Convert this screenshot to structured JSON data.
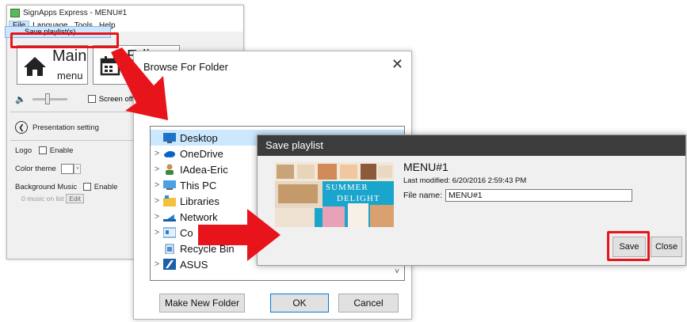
{
  "app": {
    "title": "SignApps Express - MENU#1",
    "menu": [
      "File",
      "Language",
      "Tools",
      "Help"
    ],
    "dropdown_item": "Save playlist(s)",
    "main_btn_line1": "Main",
    "main_btn_line2": "menu",
    "edit_btn_label": "Edi",
    "screen_off": "Screen off",
    "presentation_setting": "Presentation setting",
    "logo_label": "Logo",
    "logo_enable": "Enable",
    "color_theme": "Color theme",
    "bg_music": "Background Music",
    "bg_enable": "Enable",
    "music_count": "0   music on list",
    "edit_small": "Edit"
  },
  "browse": {
    "title": "Browse For Folder",
    "items": [
      {
        "label": "Desktop",
        "icon": "desktop-icon"
      },
      {
        "label": "OneDrive",
        "icon": "cloud-icon"
      },
      {
        "label": "IAdea-Eric",
        "icon": "user-icon"
      },
      {
        "label": "This PC",
        "icon": "pc-icon"
      },
      {
        "label": "Libraries",
        "icon": "libraries-icon"
      },
      {
        "label": "Network",
        "icon": "network-icon"
      },
      {
        "label": "Co",
        "icon": "control-panel-icon"
      },
      {
        "label": "Recycle Bin",
        "icon": "recycle-bin-icon"
      },
      {
        "label": "ASUS",
        "icon": "folder-icon"
      }
    ],
    "make_folder": "Make New Folder",
    "ok": "OK",
    "cancel": "Cancel"
  },
  "save": {
    "title": "Save playlist",
    "name": "MENU#1",
    "modified": "Last modified: 6/20/2016 2:59:43 PM",
    "filename_label": "File name:",
    "filename_value": "MENU#1",
    "save_btn": "Save",
    "close_btn": "Close",
    "thumb_text1": "SUMMER",
    "thumb_text2": "DELIGHT"
  },
  "colors": {
    "accent_red": "#e8141c",
    "selection": "#cce8ff",
    "dialog_title_bg": "#3c3c3c"
  }
}
